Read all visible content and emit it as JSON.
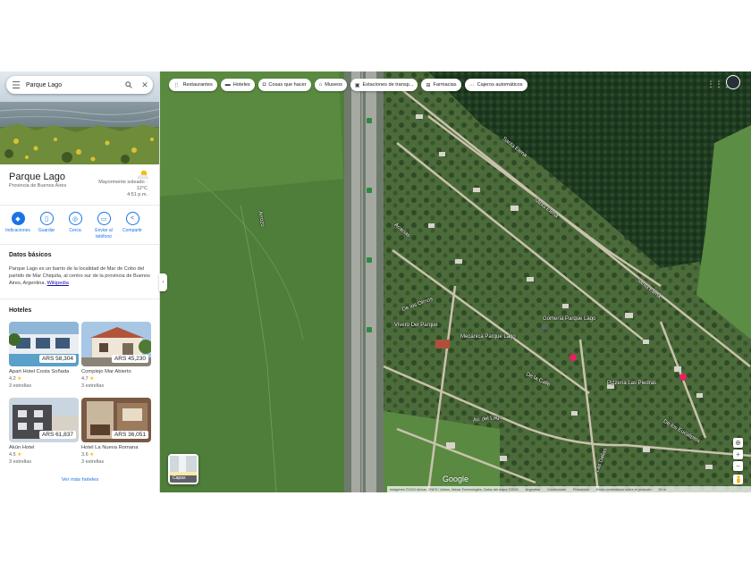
{
  "search": {
    "query": "Parque Lago"
  },
  "place": {
    "title": "Parque Lago",
    "subtitle": "Provincia de Buenos Aires",
    "weather_desc": "Mayormente soleado ·",
    "weather_temp": "12°C",
    "weather_time": "4:51 p.m."
  },
  "actions": [
    {
      "label": "Indicaciones",
      "icon": "directions-icon"
    },
    {
      "label": "Guardar",
      "icon": "bookmark-icon"
    },
    {
      "label": "Cerca",
      "icon": "nearby-icon"
    },
    {
      "label": "Enviar al teléfono",
      "icon": "phone-icon"
    },
    {
      "label": "Compartir",
      "icon": "share-icon"
    }
  ],
  "about": {
    "title": "Datos básicos",
    "text": "Parque Lago es un barrio de la localidad de Mar de Cobo del partido de Mar Chiquita, al centro sur de la provincia de Buenos Aires, Argentina.",
    "link": "Wikipedia"
  },
  "hotels": {
    "title": "Hoteles",
    "more": "Ver más hoteles",
    "items": [
      {
        "name": "Apart Hotel Costa Soñada",
        "price": "ARS 58,304",
        "rating": "4.2",
        "stars": "3 estrellas"
      },
      {
        "name": "Complejo Mar Abierto",
        "price": "ARS 45,230",
        "rating": "4.7",
        "stars": "3 estrellas"
      },
      {
        "name": "Akún Hotel",
        "price": "ARS 61,837",
        "rating": "4.5",
        "stars": "3 estrellas"
      },
      {
        "name": "Hotel La Nueva Romana",
        "price": "ARS 36,051",
        "rating": "3.6",
        "stars": "3 estrellas"
      }
    ]
  },
  "chips": [
    {
      "label": "Restaurantes",
      "icon": "restaurant-icon"
    },
    {
      "label": "Hoteles",
      "icon": "hotel-icon"
    },
    {
      "label": "Cosas que hacer",
      "icon": "camera-icon"
    },
    {
      "label": "Museos",
      "icon": "museum-icon"
    },
    {
      "label": "Estaciones de transp...",
      "icon": "transit-icon"
    },
    {
      "label": "Farmacias",
      "icon": "pharmacy-icon"
    },
    {
      "label": "Cajeros automáticos",
      "icon": "atm-icon"
    }
  ],
  "map": {
    "layers_label": "Capas",
    "logo": "Google",
    "attribution": [
      "Imágenes ©2024 Airbus, CNES / Airbus, Maxar Technologies, Datos del mapa ©2024",
      "Argentina",
      "Condiciones",
      "Privacidad",
      "Envía comentarios sobre el producto",
      "50 m"
    ],
    "labels": {
      "santa_elena_1": "Santa Elena",
      "santa_elena_2": "Santa Elena",
      "santa_elena_3": "Santa Elena",
      "de_los_olmos": "De los Olmos",
      "gomeria": "Gomería Parque Lago",
      "vivero": "Vivero Del Parque",
      "mecanica": "Mecánica Parque Lago",
      "pizzeria": "Pizzería Las Piedras",
      "de_la_calle": "De la Calle",
      "av_del_lago": "Av. del Lago",
      "acacias": "Acacias",
      "arrozo": "Arrozo",
      "los_eucaliptus": "De los Eucaliptos",
      "las_dalias": "Las Dalias",
      "route_11": "11"
    }
  },
  "colors": {
    "accent": "#1a73e8",
    "star": "#fbbc04",
    "field_green": "#4d7a38",
    "forest": "#1f3a22"
  }
}
